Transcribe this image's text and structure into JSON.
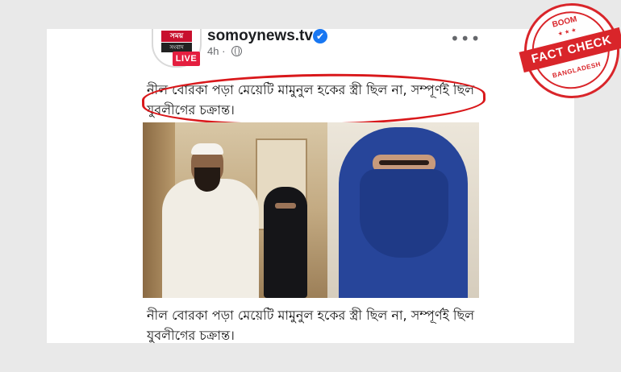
{
  "post": {
    "logo_top": "সময়",
    "logo_mid": "সংবাদ",
    "live_label": "LIVE",
    "page_name": "somoynews.tv",
    "verified_glyph": "✔",
    "time": "4h",
    "separator": "·",
    "more_glyph": "•••",
    "caption": "নীল বোরকা পড়া মেয়েটি মামুনুল হকের স্ত্রী ছিল না, সম্পূর্ণই ছিল যুবলীগের চক্রান্ত।",
    "photo_caption": "নীল বোরকা পড়া মেয়েটি মামুনুল হকের স্ত্রী ছিল না, সম্পূর্ণই ছিল যুবলীগের চক্রান্ত।"
  },
  "stamp": {
    "brand": "BOOM",
    "label": "FACT CHECK",
    "country": "BANGLADESH",
    "stars": "★ ★ ★"
  },
  "colors": {
    "stamp_red": "#d9252a",
    "live_red": "#e41e3f",
    "verified_blue": "#1877f2",
    "highlight_red": "#d9181b"
  }
}
